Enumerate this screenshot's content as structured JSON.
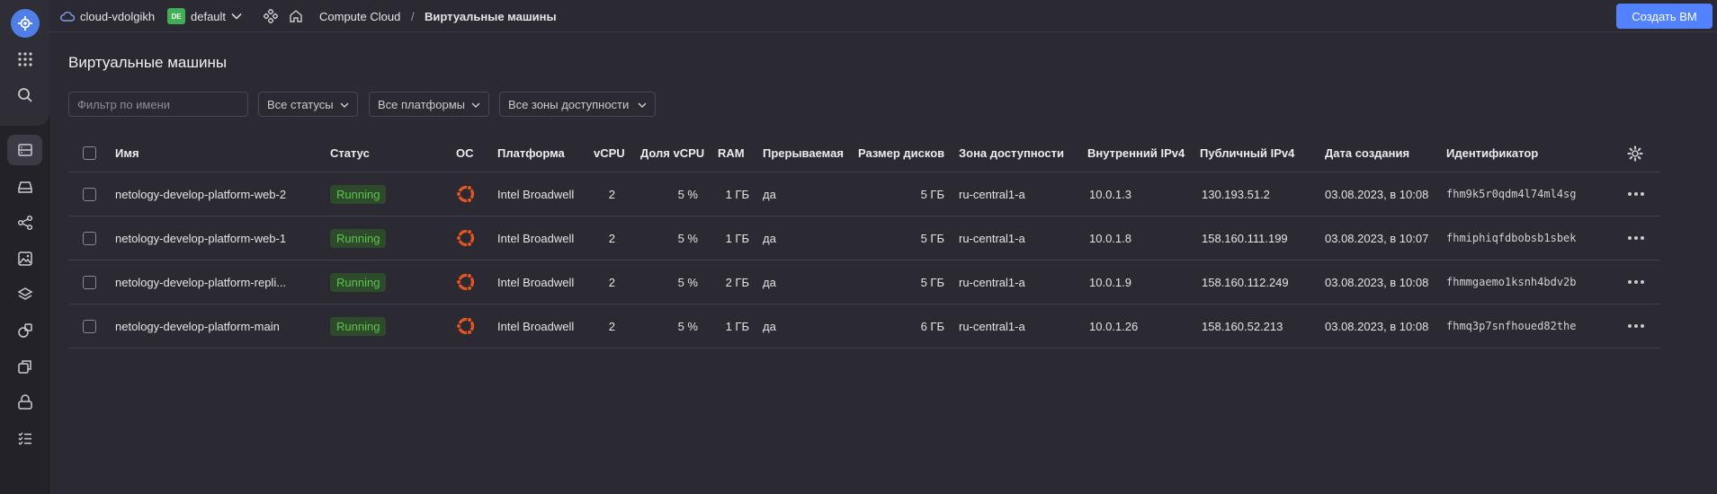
{
  "header": {
    "cloud_name": "cloud-vdolgikh",
    "folder_badge": "DE",
    "folder_name": "default",
    "service": "Compute Cloud",
    "separator": "/",
    "page": "Виртуальные машины",
    "create_button": "Создать ВМ"
  },
  "page_title": "Виртуальные машины",
  "filters": {
    "name_placeholder": "Фильтр по имени",
    "status": "Все статусы",
    "platform": "Все платформы",
    "zone": "Все зоны доступности"
  },
  "table": {
    "columns": {
      "name": "Имя",
      "status": "Статус",
      "os": "ОС",
      "platform": "Платформа",
      "vcpu": "vCPU",
      "vcpu_share": "Доля vCPU",
      "ram": "RAM",
      "preemptible": "Прерываемая",
      "disk_size": "Размер дисков",
      "zone": "Зона доступности",
      "internal_ip": "Внутренний IPv4",
      "public_ip": "Публичный IPv4",
      "created": "Дата создания",
      "id": "Идентификатор"
    },
    "rows": [
      {
        "name": "netology-develop-platform-web-2",
        "status": "Running",
        "platform": "Intel Broadwell",
        "vcpu": "2",
        "vcpu_share": "5 %",
        "ram": "1 ГБ",
        "preemptible": "да",
        "disk_size": "5 ГБ",
        "zone": "ru-central1-a",
        "internal_ip": "10.0.1.3",
        "public_ip": "130.193.51.2",
        "created": "03.08.2023, в 10:08",
        "id": "fhm9k5r0qdm4l74ml4sg"
      },
      {
        "name": "netology-develop-platform-web-1",
        "status": "Running",
        "platform": "Intel Broadwell",
        "vcpu": "2",
        "vcpu_share": "5 %",
        "ram": "1 ГБ",
        "preemptible": "да",
        "disk_size": "5 ГБ",
        "zone": "ru-central1-a",
        "internal_ip": "10.0.1.8",
        "public_ip": "158.160.111.199",
        "created": "03.08.2023, в 10:07",
        "id": "fhmiphiqfdbobsb1sbek"
      },
      {
        "name": "netology-develop-platform-repli...",
        "status": "Running",
        "platform": "Intel Broadwell",
        "vcpu": "2",
        "vcpu_share": "5 %",
        "ram": "2 ГБ",
        "preemptible": "да",
        "disk_size": "5 ГБ",
        "zone": "ru-central1-a",
        "internal_ip": "10.0.1.9",
        "public_ip": "158.160.112.249",
        "created": "03.08.2023, в 10:08",
        "id": "fhmmgaemo1ksnh4bdv2b"
      },
      {
        "name": "netology-develop-platform-main",
        "status": "Running",
        "platform": "Intel Broadwell",
        "vcpu": "2",
        "vcpu_share": "5 %",
        "ram": "1 ГБ",
        "preemptible": "да",
        "disk_size": "6 ГБ",
        "zone": "ru-central1-a",
        "internal_ip": "10.0.1.26",
        "public_ip": "158.160.52.213",
        "created": "03.08.2023, в 10:08",
        "id": "fhmq3p7snfhoued82the"
      }
    ]
  },
  "colors": {
    "accent": "#5282ff",
    "running_text": "#5dc24f",
    "running_bg": "#2d4a2a",
    "ubuntu": "#e95420"
  }
}
